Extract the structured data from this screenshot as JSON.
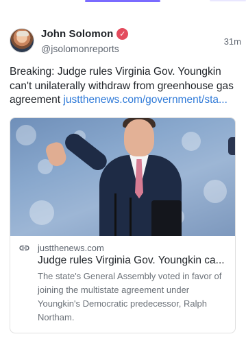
{
  "tabs": {
    "indicators": [
      "active",
      "dim"
    ]
  },
  "post": {
    "author_name": "John Solomon",
    "handle": "@jsolomonreports",
    "time": "31m",
    "text": "Breaking: Judge rules Virginia Gov. Youngkin can't unilaterally withdraw from greenhouse gas agreement ",
    "link_text": "justthenews.com/government/sta...",
    "verified_icon": "check-badge-icon"
  },
  "card": {
    "domain": "justthenews.com",
    "title": "Judge rules Virginia Gov. Youngkin ca...",
    "description": "The state's General Assembly voted in favor of joining the multistate agreement under Youngkin's Democratic predecessor, Ralph Northam.",
    "link_icon": "link-icon"
  },
  "colors": {
    "accent": "#7a6bff",
    "link": "#2f7ad8",
    "verified": "#e34b5d"
  }
}
